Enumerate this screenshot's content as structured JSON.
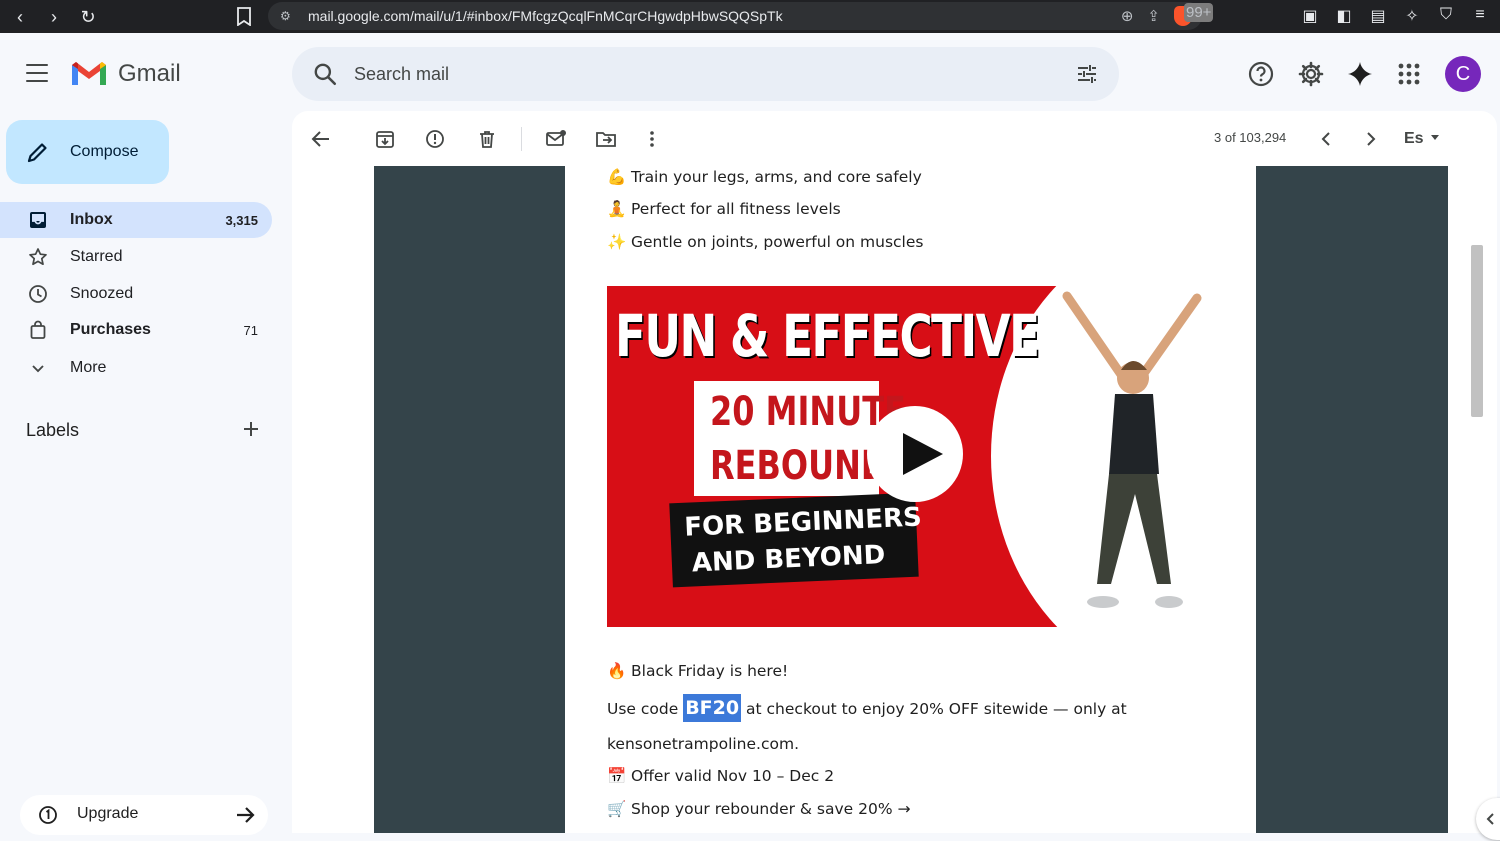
{
  "browser": {
    "url": "mail.google.com/mail/u/1/#inbox/FMfcgzQcqlFnMCqrCHgwdpHbwSQQSpTk",
    "badge": "99+"
  },
  "app": {
    "name": "Gmail"
  },
  "search": {
    "placeholder": "Search mail"
  },
  "user": {
    "avatar_initial": "C",
    "avatar_color": "#7627bb"
  },
  "sidebar": {
    "compose_label": "Compose",
    "items": [
      {
        "label": "Inbox",
        "count": "3,315",
        "icon": "inbox-icon"
      },
      {
        "label": "Starred",
        "count": "",
        "icon": "star-icon"
      },
      {
        "label": "Snoozed",
        "count": "",
        "icon": "clock-icon"
      },
      {
        "label": "Purchases",
        "count": "71",
        "icon": "bag-icon"
      },
      {
        "label": "More",
        "count": "",
        "icon": "chevron-down-icon"
      }
    ],
    "labels_heading": "Labels",
    "upgrade_label": "Upgrade"
  },
  "toolbar": {
    "pager": "3 of 103,294",
    "language": "Es"
  },
  "email": {
    "lines_top": [
      {
        "emoji": "💪",
        "text": "Train your legs, arms, and core safely"
      },
      {
        "emoji": "🧘",
        "text": "Perfect for all fitness levels"
      },
      {
        "emoji": "✨",
        "text": "Gentle on joints, powerful on muscles"
      }
    ],
    "video": {
      "title": "FUN & EFFECTIVE",
      "box_line1": "20 MINUTE",
      "box_line2": "REBOUNDER",
      "banner_line1": "FOR BEGINNERS",
      "banner_line2": "AND BEYOND"
    },
    "bf_emoji": "🔥",
    "bf_text": "Black Friday is here!",
    "code_prefix": "Use code ",
    "code": "BF20",
    "code_suffix": " at checkout to enjoy 20% OFF sitewide — only at",
    "site": "kensonetrampoline.com.",
    "offer_emoji": "📅",
    "offer_text": "Offer valid Nov 10 – Dec 2",
    "shop_emoji": "🛒",
    "shop_text": "Shop your rebounder & save 20% →"
  }
}
